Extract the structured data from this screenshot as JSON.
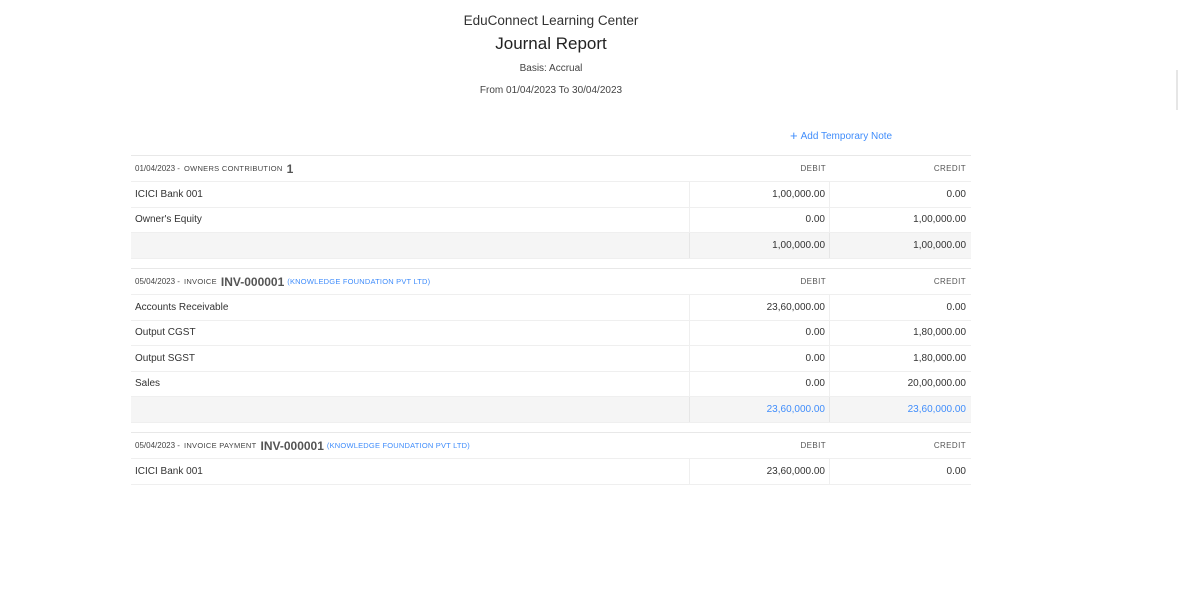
{
  "header": {
    "org_name": "EduConnect Learning Center",
    "title": "Journal Report",
    "basis": "Basis: Accrual",
    "date_range": "From 01/04/2023 To 30/04/2023"
  },
  "actions": {
    "add_note_label": "Add Temporary Note"
  },
  "columns": {
    "debit": "DEBIT",
    "credit": "CREDIT"
  },
  "entries": [
    {
      "date": "01/04/2023 -",
      "type": "OWNERS CONTRIBUTION",
      "number": "1",
      "party": "",
      "lines": [
        {
          "account": "ICICI Bank 001",
          "debit": "1,00,000.00",
          "credit": "0.00"
        },
        {
          "account": "Owner's Equity",
          "debit": "0.00",
          "credit": "1,00,000.00"
        }
      ],
      "total_debit": "1,00,000.00",
      "total_credit": "1,00,000.00"
    },
    {
      "date": "05/04/2023 -",
      "type": "INVOICE",
      "number": "INV-000001",
      "party": "(KNOWLEDGE FOUNDATION PVT LTD)",
      "lines": [
        {
          "account": "Accounts Receivable",
          "debit": "23,60,000.00",
          "credit": "0.00"
        },
        {
          "account": "Output CGST",
          "debit": "0.00",
          "credit": "1,80,000.00"
        },
        {
          "account": "Output SGST",
          "debit": "0.00",
          "credit": "1,80,000.00"
        },
        {
          "account": "Sales",
          "debit": "0.00",
          "credit": "20,00,000.00"
        }
      ],
      "total_debit": "23,60,000.00",
      "total_credit": "23,60,000.00"
    },
    {
      "date": "05/04/2023 -",
      "type": "INVOICE PAYMENT",
      "number": "INV-000001",
      "party": "(KNOWLEDGE FOUNDATION PVT LTD)",
      "lines": [
        {
          "account": "ICICI Bank 001",
          "debit": "23,60,000.00",
          "credit": "0.00"
        }
      ]
    }
  ],
  "colors": {
    "link": "#408dfb",
    "total_bg": "#f5f5f5"
  }
}
